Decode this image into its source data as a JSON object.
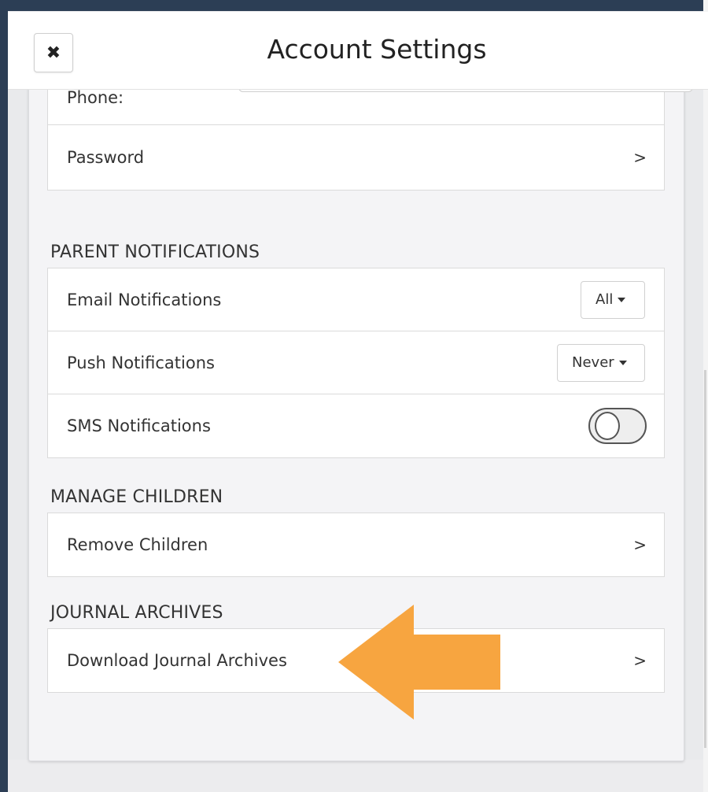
{
  "header": {
    "title": "Account Settings",
    "close_icon": "✖"
  },
  "account": {
    "phone_label": "Phone:",
    "phone_placeholder": "Phone",
    "phone_value": "",
    "password_label": "Password",
    "chevron": ">"
  },
  "parent_notifications": {
    "title": "PARENT NOTIFICATIONS",
    "email_label": "Email Notifications",
    "email_value": "All",
    "push_label": "Push Notifications",
    "push_value": "Never",
    "sms_label": "SMS Notifications",
    "sms_enabled": false
  },
  "manage_children": {
    "title": "MANAGE CHILDREN",
    "remove_label": "Remove Children",
    "chevron": ">"
  },
  "journal_archives": {
    "title": "JOURNAL ARCHIVES",
    "download_label": "Download Journal Archives",
    "chevron": ">"
  },
  "colors": {
    "arrow": "#f7a540",
    "header_bg": "#ffffff",
    "page_bg": "#f4f4f6"
  }
}
